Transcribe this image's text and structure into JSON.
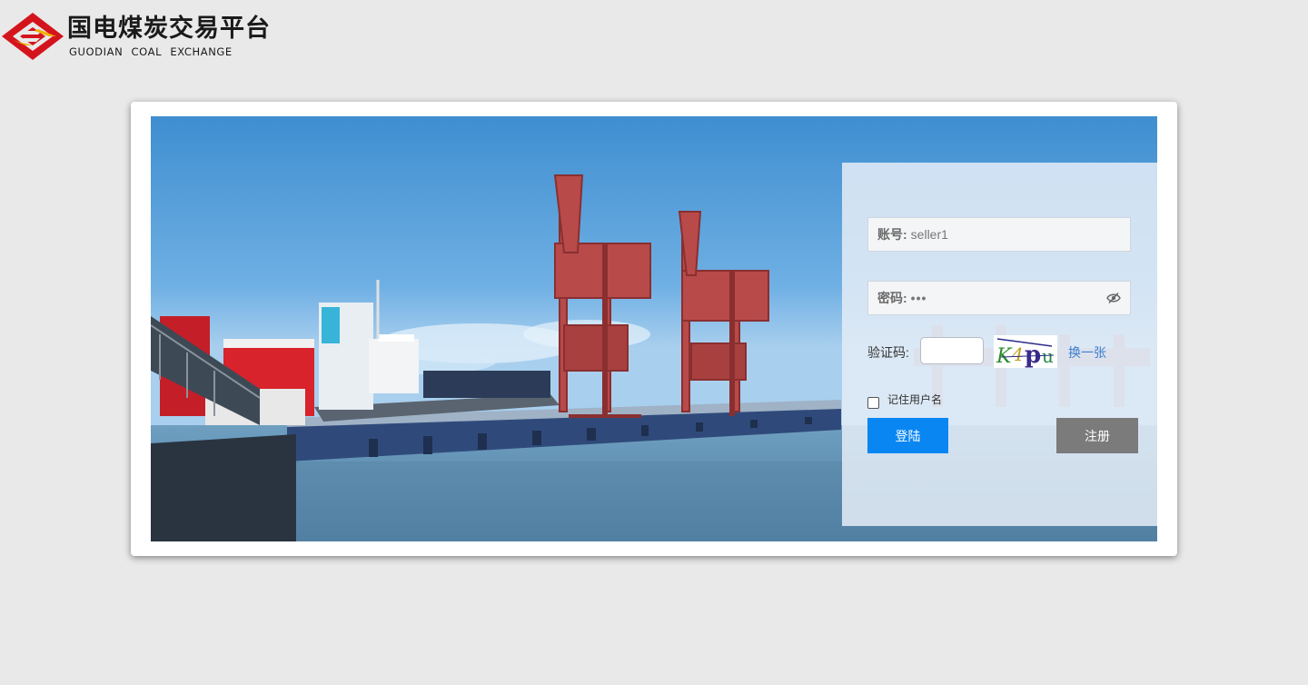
{
  "logo": {
    "title_cn": "国电煤炭交易平台",
    "title_en": "GUODIAN COAL EXCHANGE",
    "icon": "guodian-logo-icon"
  },
  "login": {
    "account": {
      "label": "账号:",
      "value": "seller1"
    },
    "password": {
      "label": "密码:",
      "value": "•••",
      "toggle_icon": "eye-slash-icon"
    },
    "captcha": {
      "label": "验证码:",
      "input_value": "",
      "image_text": "K4pu",
      "refresh_label": "换一张"
    },
    "remember": {
      "label": "记住用户名",
      "checked": false
    },
    "login_button": "登陆",
    "register_button": "注册"
  },
  "colors": {
    "login_button": "#0a86f2",
    "register_button": "#7b7b7b",
    "page_background": "#e9e9e9",
    "link": "#3a7fd0"
  }
}
